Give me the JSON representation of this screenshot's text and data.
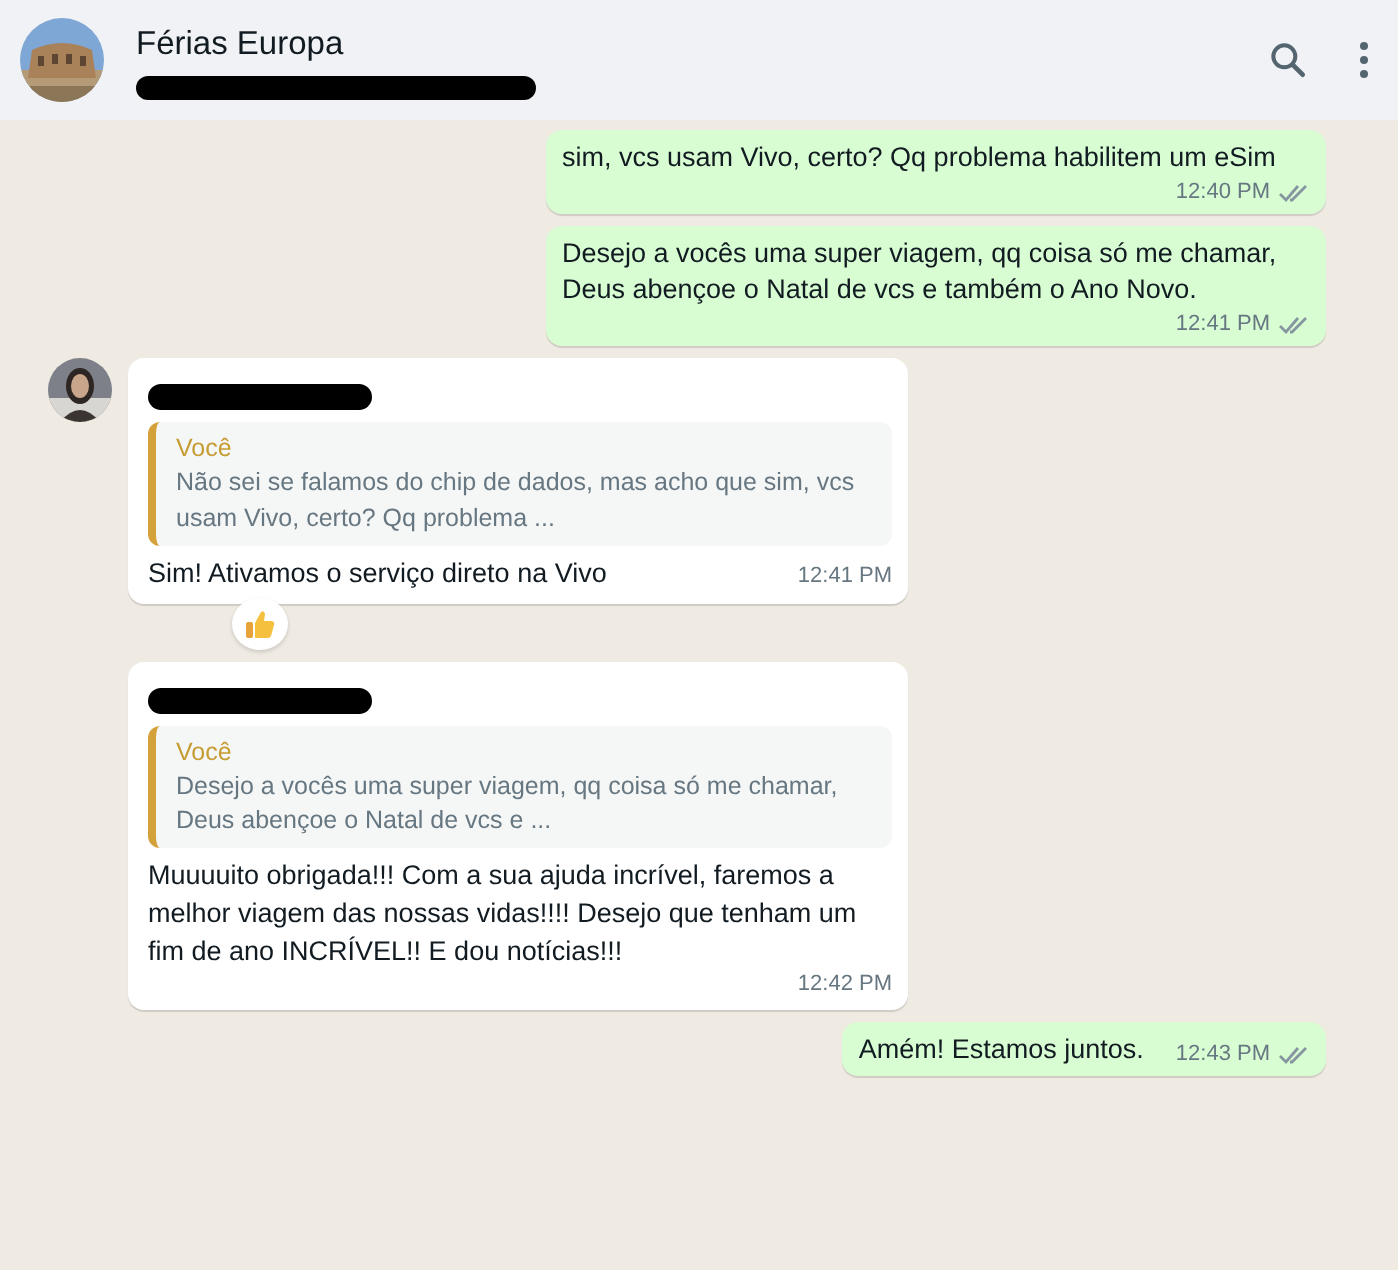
{
  "header": {
    "title": "Férias Europa",
    "subtitle_redacted": true
  },
  "messages": [
    {
      "kind": "outgoing",
      "text": "sim, vcs usam Vivo, certo? Qq problema habilitem um eSim",
      "time": "12:40 PM",
      "read": false
    },
    {
      "kind": "outgoing",
      "text": "Desejo a vocês uma super viagem, qq coisa só me chamar, Deus abençoe o Natal de vcs e também o Ano Novo.",
      "time": "12:41 PM",
      "read": false
    },
    {
      "kind": "incoming",
      "avatar": true,
      "sender_redacted": true,
      "quote": {
        "author": "Você",
        "text": "Não sei se falamos do chip de dados, mas acho que sim, vcs usam Vivo, certo? Qq problema ..."
      },
      "text": "Sim! Ativamos o serviço direto na Vivo",
      "time": "12:41 PM",
      "reacted": true
    },
    {
      "kind": "incoming",
      "avatar": false,
      "sender_redacted": true,
      "quote": {
        "author": "Você",
        "text": "Desejo a vocês uma super viagem, qq coisa só me chamar, Deus abençoe o Natal de vcs e ..."
      },
      "text": "Muuuuito obrigada!!! Com a sua ajuda incrível, faremos a melhor viagem das nossas vidas!!!! Desejo que tenham um fim de ano INCRÍVEL!! E dou notícias!!!",
      "time": "12:42 PM"
    },
    {
      "kind": "outgoing",
      "text": "Amém! Estamos juntos.",
      "time": "12:43 PM",
      "read": false
    }
  ]
}
